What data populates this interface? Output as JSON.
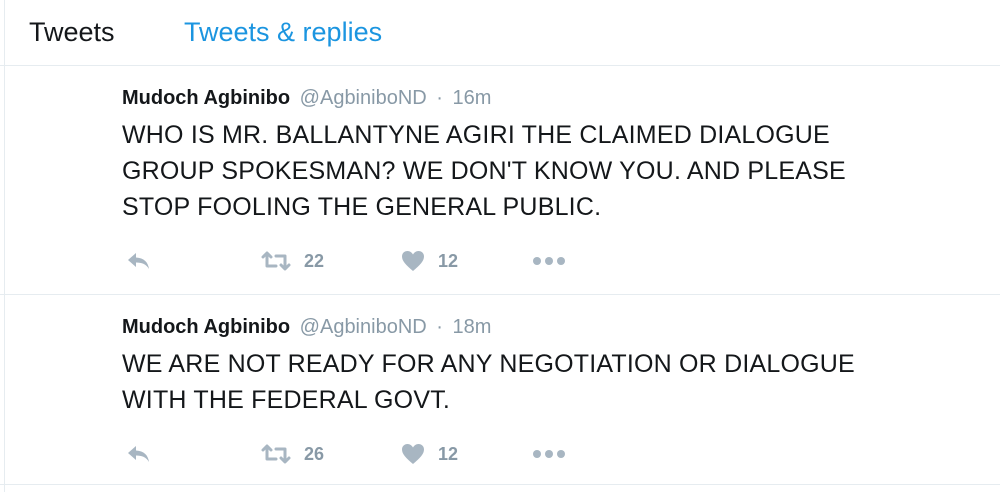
{
  "tabs": [
    {
      "label": "Tweets"
    },
    {
      "label": "Tweets & replies"
    }
  ],
  "colors": {
    "accent": "#1b95e0",
    "icon": "#a8b6c2",
    "muted": "#8899a6"
  },
  "tweets": [
    {
      "name": "Mudoch Agbinibo",
      "handle": "@AgbiniboND",
      "separator": "·",
      "time": "16m",
      "text": "WHO IS MR. BALLANTYNE AGIRI THE CLAIMED DIALOGUE\nGROUP SPOKESMAN? WE DON'T KNOW YOU. AND PLEASE\nSTOP FOOLING THE GENERAL PUBLIC.",
      "retweets": "22",
      "likes": "12"
    },
    {
      "name": "Mudoch Agbinibo",
      "handle": "@AgbiniboND",
      "separator": "·",
      "time": "18m",
      "text": "WE ARE NOT READY FOR ANY NEGOTIATION OR DIALOGUE\nWITH THE FEDERAL GOVT.",
      "retweets": "26",
      "likes": "12"
    }
  ],
  "icons": {
    "reply": "reply-icon",
    "retweet": "retweet-icon",
    "like": "heart-icon",
    "more": "more-dots-icon"
  }
}
